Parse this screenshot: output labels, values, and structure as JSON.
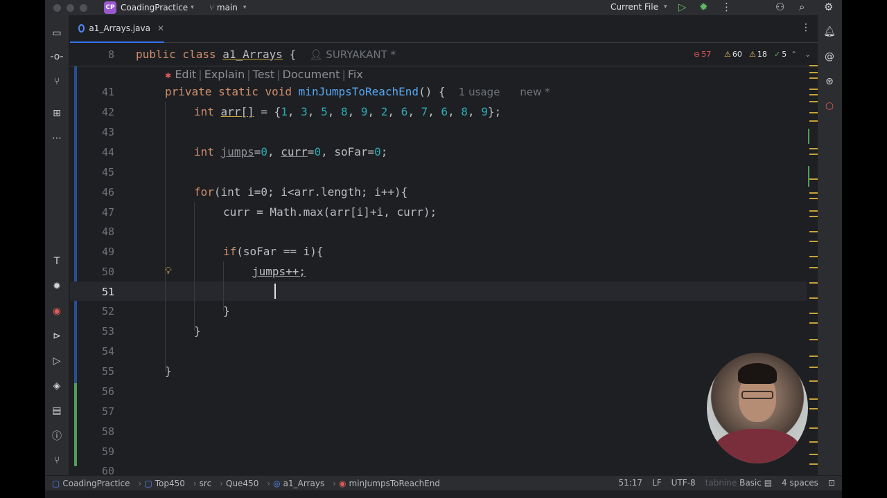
{
  "titlebar": {
    "project_badge": "CP",
    "project_name": "CoadingPractice",
    "branch": "main",
    "run_config": "Current File"
  },
  "tabs": [
    {
      "label": "a1_Arrays.java",
      "active": true
    }
  ],
  "sticky": {
    "line_no": "8",
    "code_kw": "public class",
    "code_name": "a1_Arrays",
    "code_brace": "{",
    "author": "SURYAKANT *"
  },
  "inspections": {
    "errors": "57",
    "warnings": "60",
    "weak_warnings": "18",
    "typos": "5"
  },
  "ai_actions": [
    "Edit",
    "Explain",
    "Test",
    "Document",
    "Fix"
  ],
  "code_lines": [
    {
      "n": "41"
    },
    {
      "n": "42"
    },
    {
      "n": "43"
    },
    {
      "n": "44"
    },
    {
      "n": "45"
    },
    {
      "n": "46"
    },
    {
      "n": "47"
    },
    {
      "n": "48"
    },
    {
      "n": "49"
    },
    {
      "n": "50"
    },
    {
      "n": "51"
    },
    {
      "n": "52"
    },
    {
      "n": "53"
    },
    {
      "n": "54"
    },
    {
      "n": "55"
    },
    {
      "n": "56"
    },
    {
      "n": "57"
    },
    {
      "n": "58"
    },
    {
      "n": "59"
    },
    {
      "n": "60"
    }
  ],
  "code": {
    "l41_mods": "private static void",
    "l41_name": "minJumpsToReachEnd",
    "l41_rest": "() {",
    "l41_hint_usage": "1 usage",
    "l41_hint_new": "new *",
    "l42_type": "int",
    "l42_var": "arr[]",
    "l42_eq": " = {",
    "l42_values": [
      "1",
      "3",
      "5",
      "8",
      "9",
      "2",
      "6",
      "7",
      "6",
      "8",
      "9"
    ],
    "l42_end": "};",
    "l44_type": "int",
    "l44_v1": "jumps",
    "l44_v1_init": "0",
    "l44_v2": "curr",
    "l44_v2_init": "0",
    "l44_v3": "soFar",
    "l44_v3_init": "0",
    "l46_for": "for",
    "l46_text": "(int i=0; i<arr.length; i++){",
    "l47_text": "curr = Math.max(arr[i]+i, curr);",
    "l49_if": "if",
    "l49_text": "(soFar == i){",
    "l50_text": "jumps++;",
    "l52_text": "}",
    "l53_text": "}",
    "l55_text": "}"
  },
  "statusbar": {
    "crumbs": [
      "CoadingPractice",
      "Top450",
      "src",
      "Que450",
      "a1_Arrays",
      "minJumpsToReachEnd"
    ],
    "position": "51:17",
    "line_sep": "LF",
    "encoding": "UTF-8",
    "ai_plugin": "tabnine",
    "ai_plan": "Basic",
    "indent": "4 spaces"
  },
  "colors": {
    "background": "#1e1f22",
    "panel": "#2b2d30",
    "accent": "#3574f0",
    "keyword": "#cf8e6d",
    "number": "#2aacb8",
    "function": "#56a8f5",
    "field": "#c77dbb"
  }
}
